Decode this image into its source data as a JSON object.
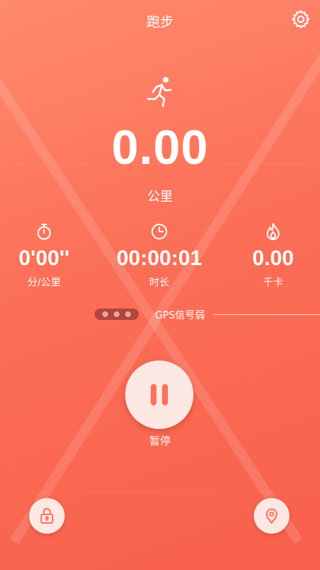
{
  "header": {
    "title": "跑步",
    "settings_icon": "gear-icon"
  },
  "activity_icon": "running-icon",
  "distance": {
    "value": "0.00",
    "unit": "公里"
  },
  "stats": [
    {
      "icon": "stopwatch-icon",
      "value": "0'00''",
      "label": "分/公里"
    },
    {
      "icon": "clock-icon",
      "value": "00:00:01",
      "label": "时长"
    },
    {
      "icon": "flame-icon",
      "value": "0.00",
      "label": "千卡"
    }
  ],
  "gps": {
    "status": "GPS信号弱"
  },
  "controls": {
    "pause_label": "暂停",
    "lock_icon": "lock-icon",
    "map_icon": "map-pin-icon"
  },
  "colors": {
    "background_top": "#ff8a6e",
    "background_bottom": "#f8604c",
    "accent": "#ff6f59",
    "button_bg": "#fde8e3"
  }
}
